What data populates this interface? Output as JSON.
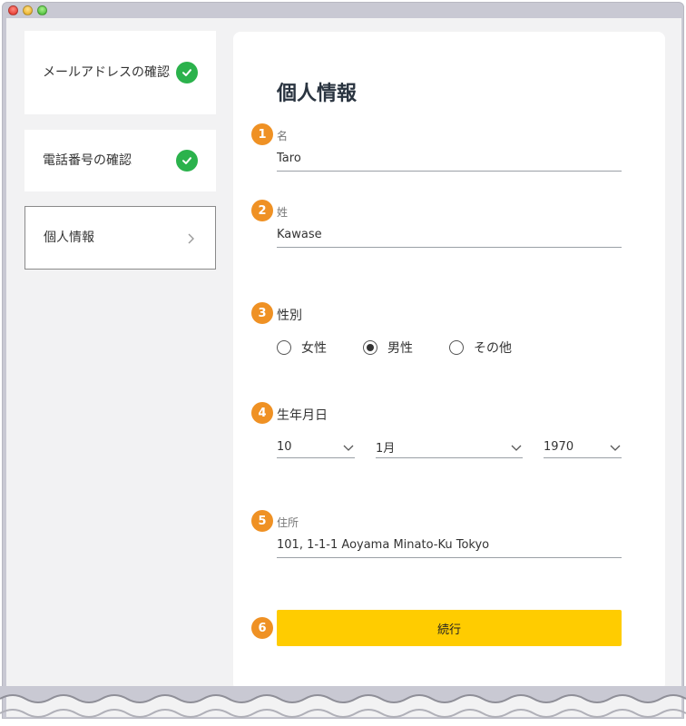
{
  "steps": [
    {
      "label": "メールアドレスの確認",
      "status": "done"
    },
    {
      "label": "電話番号の確認",
      "status": "done"
    },
    {
      "label": "個人情報",
      "status": "current"
    }
  ],
  "form": {
    "title": "個人情報",
    "first_name": {
      "number": "1",
      "label": "名",
      "value": "Taro"
    },
    "last_name": {
      "number": "2",
      "label": "姓",
      "value": "Kawase"
    },
    "gender": {
      "number": "3",
      "label": "性別",
      "options": [
        "女性",
        "男性",
        "その他"
      ],
      "selected": "男性"
    },
    "birthdate": {
      "number": "4",
      "label": "生年月日",
      "day": "10",
      "month": "1月",
      "year": "1970"
    },
    "address": {
      "number": "5",
      "label": "住所",
      "value": "101, 1-1-1 Aoyama Minato-Ku Tokyo"
    },
    "continue": {
      "number": "6",
      "label": "続行"
    }
  },
  "colors": {
    "accent_number": "#ef9124",
    "check_green": "#2bb24c",
    "button_yellow": "#ffcc00"
  }
}
